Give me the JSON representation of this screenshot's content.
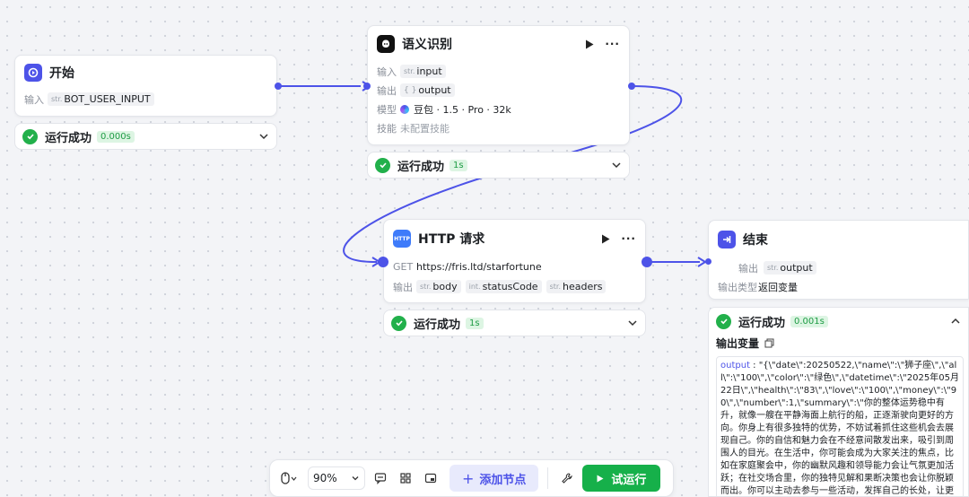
{
  "nodes": {
    "start": {
      "title": "开始",
      "input_label": "输入",
      "input_type": "str.",
      "input_name": "BOT_USER_INPUT",
      "status": "运行成功",
      "time": "0.000s"
    },
    "intent": {
      "title": "语义识别",
      "input_label": "输入",
      "input_type": "str.",
      "input_name": "input",
      "output_label": "输出",
      "output_type": "{ }",
      "output_name": "output",
      "model_label": "模型",
      "model_value": "豆包 · 1.5 · Pro · 32k",
      "skill_label": "技能",
      "skill_value": "未配置技能",
      "status": "运行成功",
      "time": "1s"
    },
    "http": {
      "title": "HTTP 请求",
      "method": "GET",
      "url": "https://fris.ltd/starfortune",
      "output_label": "输出",
      "outputs": [
        {
          "type": "str.",
          "name": "body"
        },
        {
          "type": "int.",
          "name": "statusCode"
        },
        {
          "type": "str.",
          "name": "headers"
        }
      ],
      "status": "运行成功",
      "time": "1s"
    },
    "end": {
      "title": "结束",
      "output_label": "输出",
      "output_type": "str.",
      "output_name": "output",
      "output_kind_label": "输出类型",
      "output_kind_value": "返回变量",
      "status": "运行成功",
      "time": "0.001s",
      "vars_title": "输出变量",
      "output_key": "output",
      "output_text": " : \"{\\\"date\\\":20250522,\\\"name\\\":\\\"狮子座\\\",\\\"all\\\":\\\"100\\\",\\\"color\\\":\\\"绿色\\\",\\\"datetime\\\":\\\"2025年05月22日\\\",\\\"health\\\":\\\"83\\\",\\\"love\\\":\\\"100\\\",\\\"money\\\":\\\"90\\\",\\\"number\\\":1,\\\"summary\\\":\\\"你的整体运势稳中有升，就像一艘在平静海面上航行的船，正逐渐驶向更好的方向。你身上有很多独特的优势，不妨试着抓住这些机会去展现自己。你的自信和魅力会在不经意间散发出来，吸引到周围人的目光。在生活中，你可能会成为大家关注的焦点，比如在家庭聚会中，你的幽默风趣和领导能力会让气氛更加活跃；在社交场合里，你的独特见解和果断决策也会让你脱颖而出。你可以主动去参与一些活动，发挥自己的长处，让更多的人看到你的闪光点。同时，这种积极的表现也会让你获得更多的认可和机会，为未"
    }
  },
  "toolbar": {
    "zoom": "90%",
    "add_node": "添加节点",
    "run": "试运行"
  },
  "colors": {
    "accent": "#4d53e8",
    "success": "#22b04b",
    "run": "#16b04a"
  }
}
